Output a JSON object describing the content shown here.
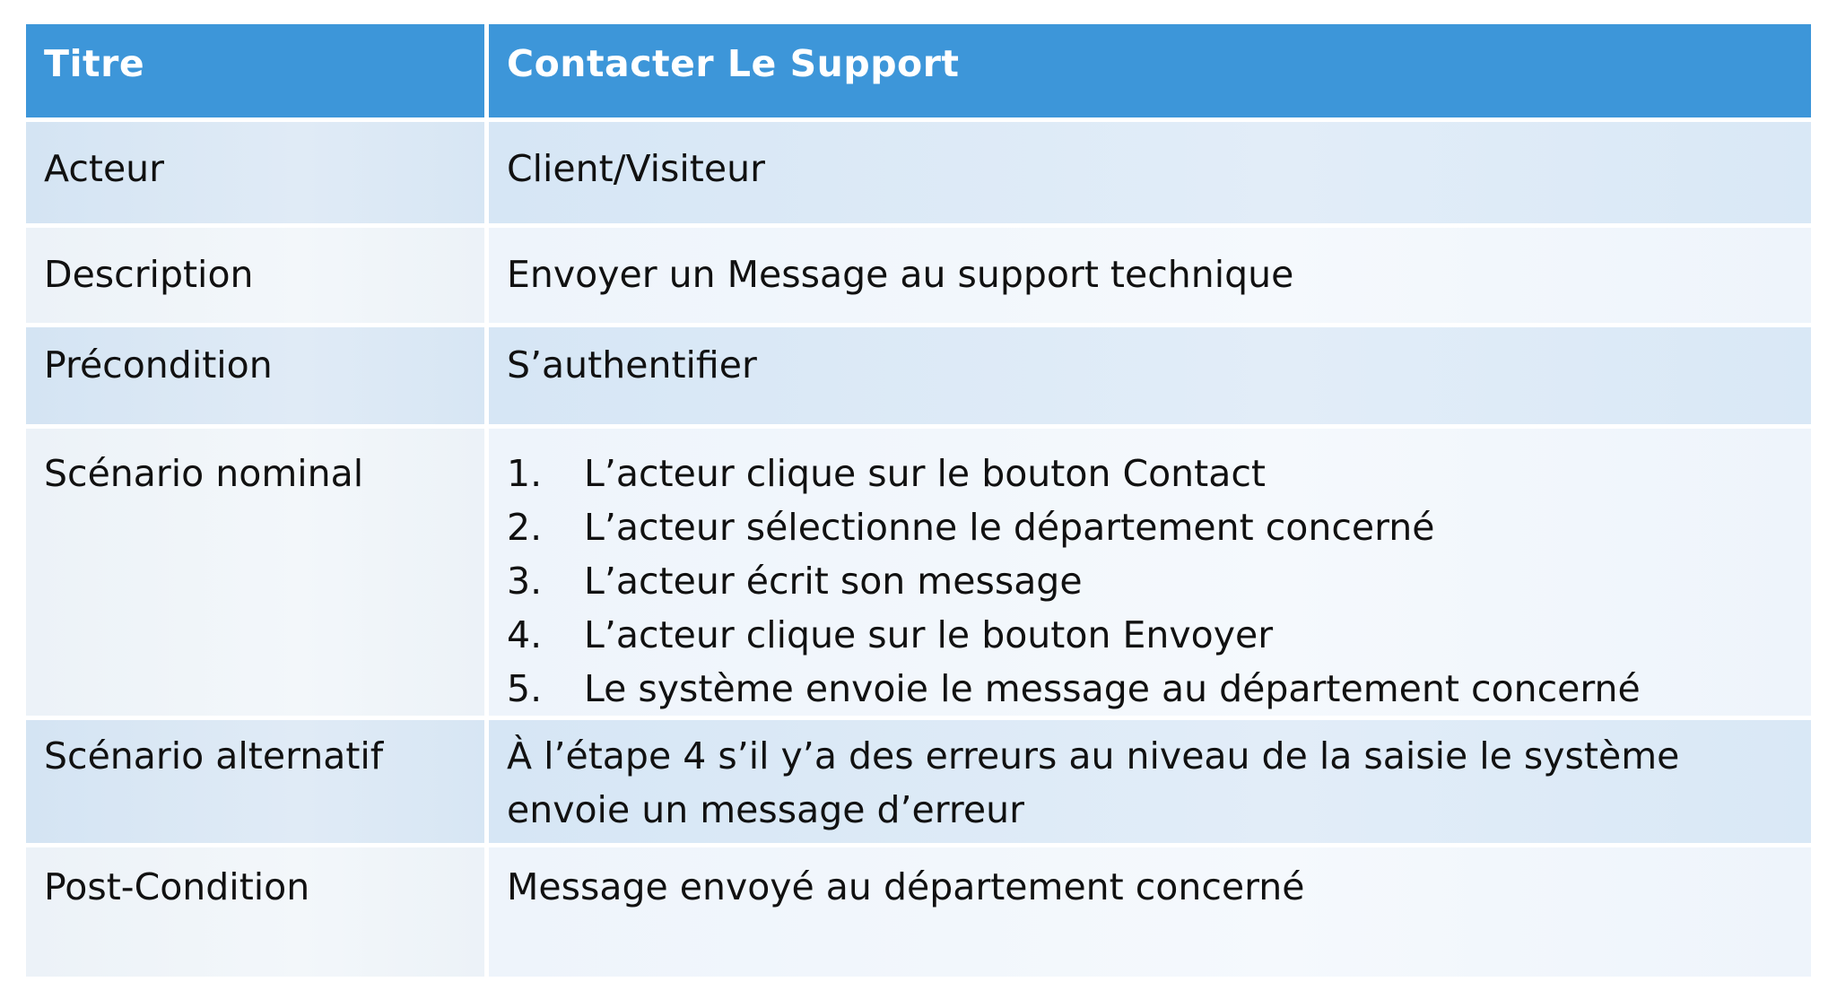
{
  "table": {
    "header": {
      "label": "Titre",
      "value": "Contacter  Le Support"
    },
    "rows": {
      "acteur": {
        "label": "Acteur",
        "value": "Client/Visiteur"
      },
      "description": {
        "label": "Description",
        "value": "Envoyer un Message au support technique"
      },
      "precondition": {
        "label": "Précondition",
        "value": "S’authentifier"
      },
      "nominal": {
        "label": "Scénario nominal",
        "steps": [
          {
            "num": "1.",
            "text": "L’acteur clique sur le bouton Contact"
          },
          {
            "num": "2.",
            "text": "L’acteur sélectionne le département concerné"
          },
          {
            "num": "3.",
            "text": "L’acteur écrit son message"
          },
          {
            "num": "4.",
            "text": "L’acteur clique sur le bouton Envoyer"
          },
          {
            "num": "5.",
            "text": "Le système envoie le message au département concerné"
          }
        ]
      },
      "alternatif": {
        "label": "Scénario alternatif",
        "value": "À l’étape 4 s’il y’a des erreurs au niveau de la saisie le système envoie un message d’erreur"
      },
      "post": {
        "label": "Post-Condition",
        "value": "Message envoyé au département concerné"
      }
    }
  },
  "colors": {
    "header_bg": "#3d96d9",
    "header_text": "#ffffff",
    "band_dark": "#d9e8f6",
    "band_light": "#f0f6fc",
    "body_text": "#111111"
  }
}
